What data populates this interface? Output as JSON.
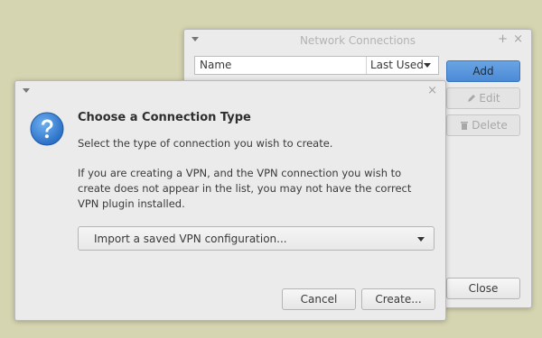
{
  "network_window": {
    "title": "Network Connections",
    "pin_glyph": "+",
    "close_glyph": "×",
    "list": {
      "columns": [
        {
          "label": "Name"
        },
        {
          "label": "Last Used"
        }
      ]
    },
    "buttons": {
      "add": "Add",
      "edit": "Edit",
      "delete": "Delete",
      "close": "Close"
    }
  },
  "dialog": {
    "close_glyph": "×",
    "heading": "Choose a Connection Type",
    "description": "Select the type of connection you wish to create.",
    "vpn_note": "If you are creating a VPN, and the VPN connection you wish to create does not appear in the list, you may not have the correct VPN plugin installed.",
    "connection_type": {
      "selected": "Import a saved VPN configuration..."
    },
    "buttons": {
      "cancel": "Cancel",
      "create": "Create..."
    }
  },
  "colors": {
    "desktop": "#d6d5b1",
    "window_bg": "#ebebeb",
    "accent": "#5595de"
  }
}
